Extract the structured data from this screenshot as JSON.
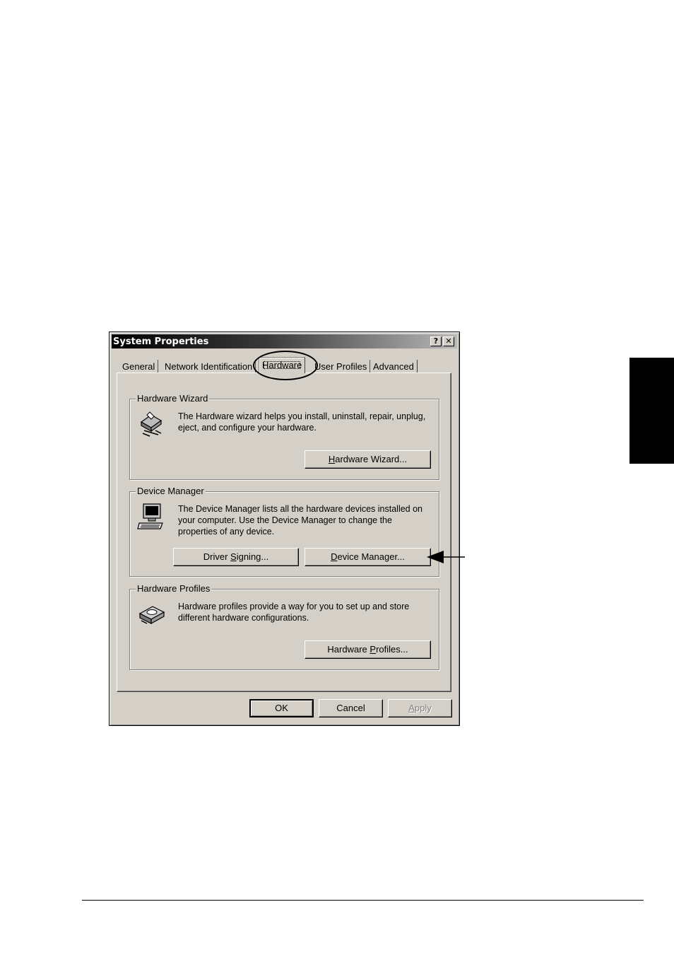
{
  "dialog": {
    "title": "System Properties",
    "help_button": "?",
    "close_button": "✕",
    "tabs": [
      {
        "label": "General"
      },
      {
        "label": "Network Identification"
      },
      {
        "label": "Hardware"
      },
      {
        "label": "User Profiles"
      },
      {
        "label": "Advanced"
      }
    ],
    "active_tab": "Hardware"
  },
  "hardware_wizard": {
    "group_label": "Hardware Wizard",
    "description": "The Hardware wizard helps you install, uninstall, repair, unplug, eject, and configure your hardware.",
    "button": {
      "pre": "",
      "key": "H",
      "post": "ardware Wizard..."
    },
    "icon": "hardware-wizard-icon"
  },
  "device_manager": {
    "group_label": "Device Manager",
    "description": "The Device Manager lists all the hardware devices installed on your computer. Use the Device Manager to change the properties of any device.",
    "driver_signing_button": {
      "pre": "Driver ",
      "key": "S",
      "post": "igning..."
    },
    "device_manager_button": {
      "pre": "",
      "key": "D",
      "post": "evice Manager..."
    },
    "icon": "computer-icon"
  },
  "hardware_profiles": {
    "group_label": "Hardware Profiles",
    "description": "Hardware profiles provide a way for you to set up and store different hardware configurations.",
    "button": {
      "pre": "Hardware ",
      "key": "P",
      "post": "rofiles..."
    },
    "icon": "hardware-profiles-icon"
  },
  "footer_buttons": {
    "ok": "OK",
    "cancel": "Cancel",
    "apply": {
      "pre": "",
      "key": "A",
      "post": "pply"
    }
  },
  "colors": {
    "dialog_face": "#d4d0c8",
    "titlebar_start": "#000000",
    "titlebar_end": "#b8b8b8"
  }
}
